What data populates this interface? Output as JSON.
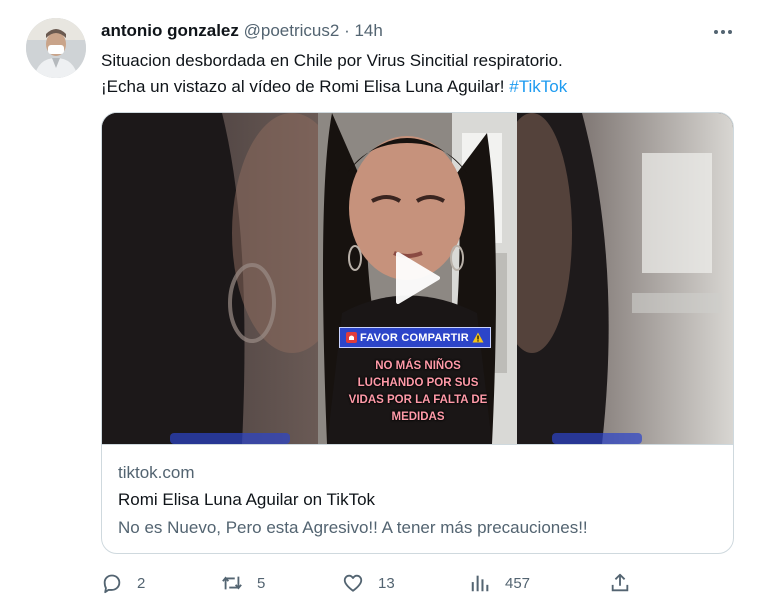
{
  "tweet": {
    "author_name": "antonio gonzalez",
    "handle": "@poetricus2",
    "separator": "·",
    "time": "14h",
    "text_line1": "Situacion desbordada en Chile por Virus Sincitial respiratorio.",
    "text_line2": "¡Echa un vistazo al vídeo de Romi Elisa Luna Aguilar!",
    "hashtag": "#TikTok"
  },
  "card": {
    "overlay_badge": "FAVOR COMPARTIR",
    "overlay_caption": [
      "NO MÁS NIÑOS",
      "LUCHANDO POR SUS",
      "VIDAS POR LA FALTA DE",
      "MEDIDAS"
    ],
    "domain": "tiktok.com",
    "title": "Romi Elisa Luna Aguilar on TikTok",
    "description": "No es Nuevo, Pero esta Agresivo!! A tener más precauciones!!"
  },
  "actions": {
    "replies": "2",
    "retweets": "5",
    "likes": "13",
    "views": "457"
  },
  "icons": [
    "reply-icon",
    "retweet-icon",
    "like-icon",
    "views-icon",
    "share-icon",
    "more-icon",
    "play-icon",
    "siren-icon",
    "warning-icon"
  ],
  "colors": {
    "link": "#1d9bf0",
    "muted": "#536471",
    "text": "#0f1419",
    "badge": "#2c45c9",
    "caption": "#ff9aa8"
  }
}
